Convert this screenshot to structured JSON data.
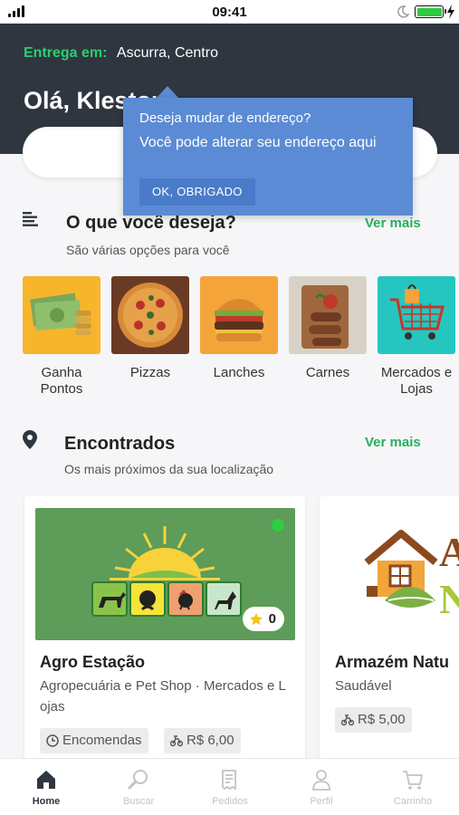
{
  "status_bar": {
    "time": "09:41"
  },
  "header": {
    "delivery_label": "Entrega em:",
    "delivery_address": "Ascurra, Centro",
    "greeting": "Olá, Kleston"
  },
  "tooltip": {
    "title": "Deseja mudar de endereço?",
    "body": "Você pode alterar seu endereço aqui",
    "button": "OK, OBRIGADO"
  },
  "categories_section": {
    "title": "O que você deseja?",
    "subtitle": "São várias opções para você",
    "see_more": "Ver mais",
    "items": [
      {
        "label": "Ganha Pontos",
        "icon": "money-icon"
      },
      {
        "label": "Pizzas",
        "icon": "pizza-icon"
      },
      {
        "label": "Lanches",
        "icon": "burger-icon"
      },
      {
        "label": "Carnes",
        "icon": "meat-icon"
      },
      {
        "label": "Mercados e Lojas",
        "icon": "cart-icon"
      }
    ]
  },
  "stores_section": {
    "title": "Encontrados",
    "subtitle": "Os mais próximos da sua localização",
    "see_more": "Ver mais",
    "stores": [
      {
        "name": "Agro Estação",
        "category": "Agropecuária e Pet Shop · Mercados e Lojas",
        "rating": "0",
        "tag_order": "Encomendas",
        "delivery_fee": "R$ 6,00",
        "open": true
      },
      {
        "name": "Armazém Natu",
        "category": "Saudável",
        "delivery_fee": "R$ 5,00"
      }
    ]
  },
  "bottom_nav": {
    "items": [
      {
        "label": "Home",
        "icon": "home-icon",
        "active": true
      },
      {
        "label": "Buscar",
        "icon": "search-icon",
        "active": false
      },
      {
        "label": "Pedidos",
        "icon": "receipt-icon",
        "active": false
      },
      {
        "label": "Perfil",
        "icon": "user-icon",
        "active": false
      },
      {
        "label": "Carrinho",
        "icon": "cart-icon",
        "active": false
      }
    ]
  },
  "colors": {
    "header_bg": "#2f3640",
    "accent_green": "#27ae60",
    "tooltip_bg": "#5b8bd5"
  }
}
